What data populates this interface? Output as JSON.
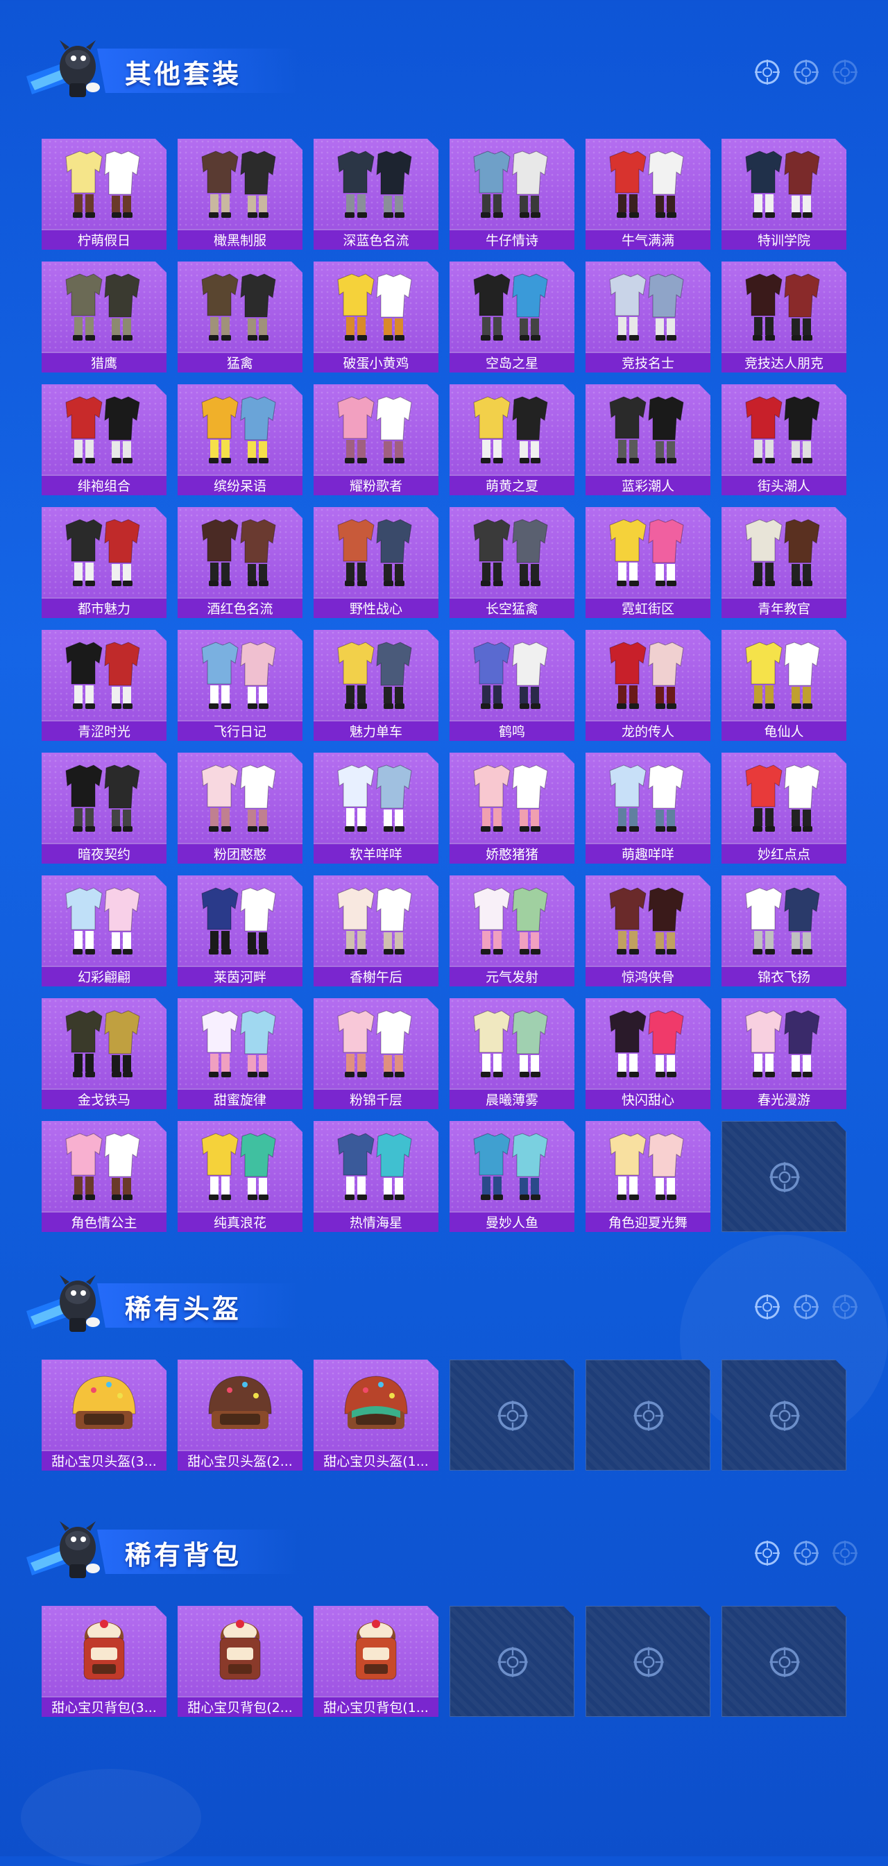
{
  "sections": [
    {
      "title": "其他套装",
      "items": [
        "柠萌假日",
        "橄黑制服",
        "深蓝色名流",
        "牛仔情诗",
        "牛气满满",
        "特训学院",
        "猎鹰",
        "猛禽",
        "破蛋小黄鸡",
        "空岛之星",
        "竞技名士",
        "竞技达人朋克",
        "绯袍组合",
        "缤纷呆语",
        "耀粉歌者",
        "萌黄之夏",
        "蓝彩潮人",
        "街头潮人",
        "都市魅力",
        "酒红色名流",
        "野性战心",
        "长空猛禽",
        "霓虹街区",
        "青年教官",
        "青涩时光",
        "飞行日记",
        "魅力单车",
        "鹤鸣",
        "龙的传人",
        "龟仙人",
        "暗夜契约",
        "粉团憨憨",
        "软羊咩咩",
        "娇憨猪猪",
        "萌趣咩咩",
        "妙红点点",
        "幻彩翩翩",
        "莱茵河畔",
        "香榭午后",
        "元气发射",
        "惊鸿侠骨",
        "锦衣飞扬",
        "金戈铁马",
        "甜蜜旋律",
        "粉锦千层",
        "晨曦薄雾",
        "快闪甜心",
        "春光漫游",
        "角色情公主",
        "纯真浪花",
        "热情海星",
        "曼妙人鱼",
        "角色迎夏光舞"
      ],
      "empty_slots": 1
    },
    {
      "title": "稀有头盔",
      "items": [
        "甜心宝贝头盔(3...",
        "甜心宝贝头盔(2...",
        "甜心宝贝头盔(1..."
      ],
      "empty_slots": 3
    },
    {
      "title": "稀有背包",
      "items": [
        "甜心宝贝背包(3...",
        "甜心宝贝背包(2...",
        "甜心宝贝背包(1..."
      ],
      "empty_slots": 3
    }
  ],
  "icons": {
    "mascot": "mascot-icon",
    "deco": "crosshair-icon",
    "empty": "crosshair-icon"
  },
  "colors": {
    "card": "#b46ef0",
    "label": "#7a26cf",
    "empty": "#1e3d78"
  }
}
